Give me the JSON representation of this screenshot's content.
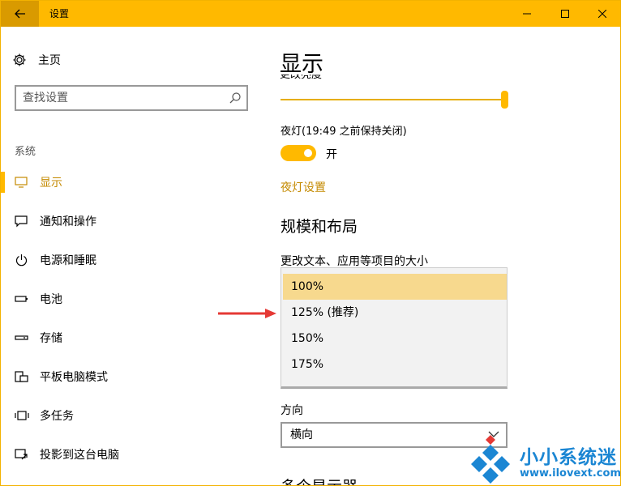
{
  "window": {
    "title": "设置",
    "controls": [
      "minimize",
      "maximize",
      "close"
    ]
  },
  "nav": {
    "home_label": "主页",
    "search_placeholder": "查找设置",
    "section_label": "系统",
    "items": [
      {
        "label": "显示",
        "icon": "monitor-icon",
        "active": true
      },
      {
        "label": "通知和操作",
        "icon": "message-icon"
      },
      {
        "label": "电源和睡眠",
        "icon": "power-icon"
      },
      {
        "label": "电池",
        "icon": "battery-icon"
      },
      {
        "label": "存储",
        "icon": "storage-icon"
      },
      {
        "label": "平板电脑模式",
        "icon": "tablet-icon"
      },
      {
        "label": "多任务",
        "icon": "multitask-icon"
      },
      {
        "label": "投影到这台电脑",
        "icon": "project-icon"
      }
    ]
  },
  "main": {
    "title": "显示",
    "brightness_label": "更改亮度",
    "brightness_value": 1.0,
    "night_light_label": "夜灯(19:49 之前保持关闭)",
    "night_light_state": "开",
    "night_light_settings_link": "夜灯设置",
    "scale_section_title": "规模和布局",
    "scale_label": "更改文本、应用等项目的大小",
    "scale_options": [
      "100%",
      "125% (推荐)",
      "150%",
      "175%"
    ],
    "scale_selected_index": 0,
    "orientation_label": "方向",
    "orientation_value": "横向",
    "bottom_heading": "多个显示器"
  },
  "watermark": {
    "text_cn": "小小系统迷",
    "url": "www.ilovext.com"
  },
  "colors": {
    "accent": "#ffb900",
    "accent_dark": "#c48a00",
    "selected_option": "#f7d98e",
    "arrow": "#e53935",
    "watermark": "#1b86d3"
  }
}
